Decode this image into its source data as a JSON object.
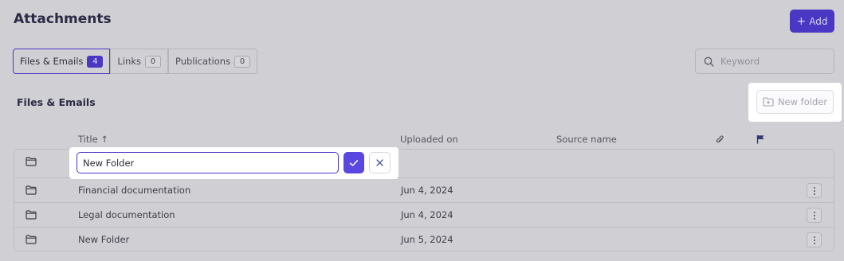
{
  "header": {
    "title": "Attachments",
    "add_label": "Add"
  },
  "tabs": [
    {
      "label": "Files & Emails",
      "count": "4",
      "active": true
    },
    {
      "label": "Links",
      "count": "0",
      "active": false
    },
    {
      "label": "Publications",
      "count": "0",
      "active": false
    }
  ],
  "search": {
    "placeholder": "Keyword",
    "value": ""
  },
  "section": {
    "title": "Files & Emails",
    "new_folder_label": "New folder"
  },
  "table": {
    "columns": {
      "title": "Title ↑",
      "uploaded_on": "Uploaded on",
      "source_name": "Source name"
    },
    "rows": [
      {
        "title": "",
        "uploaded_on": ""
      },
      {
        "title": "Financial documentation",
        "uploaded_on": "Jun 4, 2024"
      },
      {
        "title": "Legal documentation",
        "uploaded_on": "Jun 4, 2024"
      },
      {
        "title": "New Folder",
        "uploaded_on": "Jun 5, 2024"
      }
    ]
  },
  "editor": {
    "value": "New Folder"
  },
  "icons": {
    "search": "search-icon",
    "folder": "folder-icon",
    "new_folder": "folder-plus-icon",
    "attachment": "paperclip-icon",
    "flag": "flag-icon",
    "confirm": "check-icon",
    "cancel": "close-icon",
    "menu": "more-vertical-icon",
    "add": "plus-icon"
  },
  "colors": {
    "accent": "#4a37c4",
    "accent_bright": "#5a46e0"
  }
}
